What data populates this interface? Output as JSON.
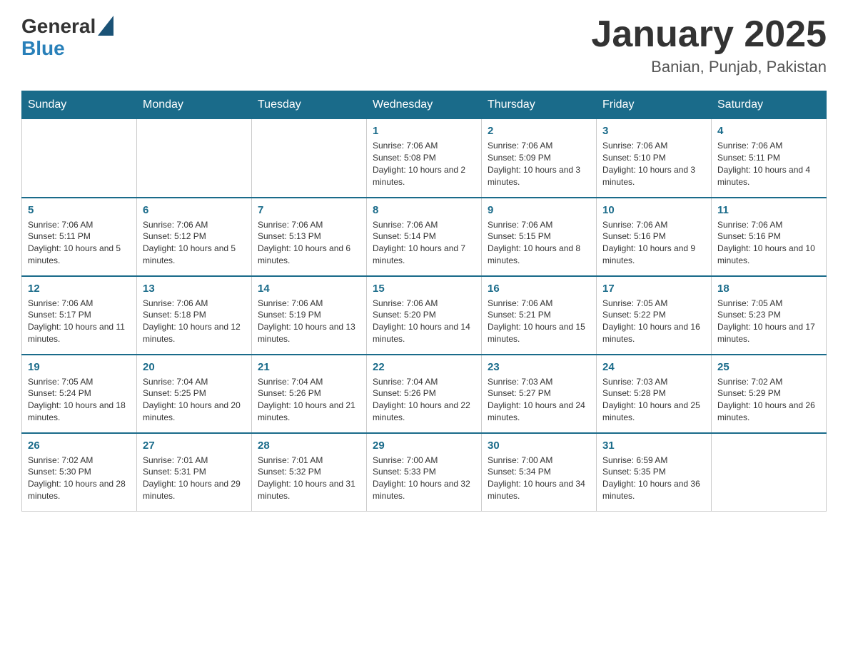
{
  "header": {
    "logo_general": "General",
    "logo_blue": "Blue",
    "title": "January 2025",
    "subtitle": "Banian, Punjab, Pakistan"
  },
  "days_of_week": [
    "Sunday",
    "Monday",
    "Tuesday",
    "Wednesday",
    "Thursday",
    "Friday",
    "Saturday"
  ],
  "weeks": [
    [
      {
        "day": "",
        "info": ""
      },
      {
        "day": "",
        "info": ""
      },
      {
        "day": "",
        "info": ""
      },
      {
        "day": "1",
        "info": "Sunrise: 7:06 AM\nSunset: 5:08 PM\nDaylight: 10 hours and 2 minutes."
      },
      {
        "day": "2",
        "info": "Sunrise: 7:06 AM\nSunset: 5:09 PM\nDaylight: 10 hours and 3 minutes."
      },
      {
        "day": "3",
        "info": "Sunrise: 7:06 AM\nSunset: 5:10 PM\nDaylight: 10 hours and 3 minutes."
      },
      {
        "day": "4",
        "info": "Sunrise: 7:06 AM\nSunset: 5:11 PM\nDaylight: 10 hours and 4 minutes."
      }
    ],
    [
      {
        "day": "5",
        "info": "Sunrise: 7:06 AM\nSunset: 5:11 PM\nDaylight: 10 hours and 5 minutes."
      },
      {
        "day": "6",
        "info": "Sunrise: 7:06 AM\nSunset: 5:12 PM\nDaylight: 10 hours and 5 minutes."
      },
      {
        "day": "7",
        "info": "Sunrise: 7:06 AM\nSunset: 5:13 PM\nDaylight: 10 hours and 6 minutes."
      },
      {
        "day": "8",
        "info": "Sunrise: 7:06 AM\nSunset: 5:14 PM\nDaylight: 10 hours and 7 minutes."
      },
      {
        "day": "9",
        "info": "Sunrise: 7:06 AM\nSunset: 5:15 PM\nDaylight: 10 hours and 8 minutes."
      },
      {
        "day": "10",
        "info": "Sunrise: 7:06 AM\nSunset: 5:16 PM\nDaylight: 10 hours and 9 minutes."
      },
      {
        "day": "11",
        "info": "Sunrise: 7:06 AM\nSunset: 5:16 PM\nDaylight: 10 hours and 10 minutes."
      }
    ],
    [
      {
        "day": "12",
        "info": "Sunrise: 7:06 AM\nSunset: 5:17 PM\nDaylight: 10 hours and 11 minutes."
      },
      {
        "day": "13",
        "info": "Sunrise: 7:06 AM\nSunset: 5:18 PM\nDaylight: 10 hours and 12 minutes."
      },
      {
        "day": "14",
        "info": "Sunrise: 7:06 AM\nSunset: 5:19 PM\nDaylight: 10 hours and 13 minutes."
      },
      {
        "day": "15",
        "info": "Sunrise: 7:06 AM\nSunset: 5:20 PM\nDaylight: 10 hours and 14 minutes."
      },
      {
        "day": "16",
        "info": "Sunrise: 7:06 AM\nSunset: 5:21 PM\nDaylight: 10 hours and 15 minutes."
      },
      {
        "day": "17",
        "info": "Sunrise: 7:05 AM\nSunset: 5:22 PM\nDaylight: 10 hours and 16 minutes."
      },
      {
        "day": "18",
        "info": "Sunrise: 7:05 AM\nSunset: 5:23 PM\nDaylight: 10 hours and 17 minutes."
      }
    ],
    [
      {
        "day": "19",
        "info": "Sunrise: 7:05 AM\nSunset: 5:24 PM\nDaylight: 10 hours and 18 minutes."
      },
      {
        "day": "20",
        "info": "Sunrise: 7:04 AM\nSunset: 5:25 PM\nDaylight: 10 hours and 20 minutes."
      },
      {
        "day": "21",
        "info": "Sunrise: 7:04 AM\nSunset: 5:26 PM\nDaylight: 10 hours and 21 minutes."
      },
      {
        "day": "22",
        "info": "Sunrise: 7:04 AM\nSunset: 5:26 PM\nDaylight: 10 hours and 22 minutes."
      },
      {
        "day": "23",
        "info": "Sunrise: 7:03 AM\nSunset: 5:27 PM\nDaylight: 10 hours and 24 minutes."
      },
      {
        "day": "24",
        "info": "Sunrise: 7:03 AM\nSunset: 5:28 PM\nDaylight: 10 hours and 25 minutes."
      },
      {
        "day": "25",
        "info": "Sunrise: 7:02 AM\nSunset: 5:29 PM\nDaylight: 10 hours and 26 minutes."
      }
    ],
    [
      {
        "day": "26",
        "info": "Sunrise: 7:02 AM\nSunset: 5:30 PM\nDaylight: 10 hours and 28 minutes."
      },
      {
        "day": "27",
        "info": "Sunrise: 7:01 AM\nSunset: 5:31 PM\nDaylight: 10 hours and 29 minutes."
      },
      {
        "day": "28",
        "info": "Sunrise: 7:01 AM\nSunset: 5:32 PM\nDaylight: 10 hours and 31 minutes."
      },
      {
        "day": "29",
        "info": "Sunrise: 7:00 AM\nSunset: 5:33 PM\nDaylight: 10 hours and 32 minutes."
      },
      {
        "day": "30",
        "info": "Sunrise: 7:00 AM\nSunset: 5:34 PM\nDaylight: 10 hours and 34 minutes."
      },
      {
        "day": "31",
        "info": "Sunrise: 6:59 AM\nSunset: 5:35 PM\nDaylight: 10 hours and 36 minutes."
      },
      {
        "day": "",
        "info": ""
      }
    ]
  ]
}
